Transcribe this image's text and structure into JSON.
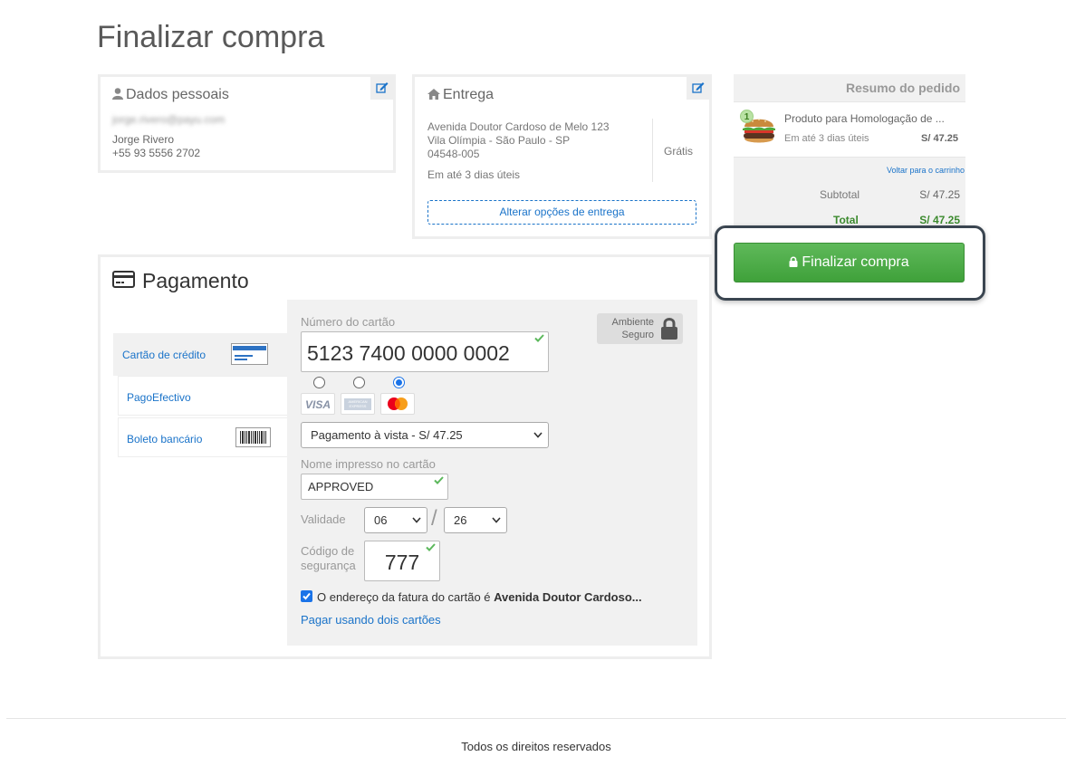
{
  "page": {
    "title": "Finalizar compra"
  },
  "personal": {
    "heading": "Dados pessoais",
    "email": "jorge.rivero@payu.com",
    "name": "Jorge Rivero",
    "phone": "+55 93 5556 2702"
  },
  "shipping": {
    "heading": "Entrega",
    "address_line1": "Avenida Doutor Cardoso de Melo 123",
    "address_line2": "Vila Olímpia - São Paulo - SP",
    "postal_code": "04548-005",
    "eta": "Em até 3 dias úteis",
    "price": "Grátis",
    "change_button": "Alterar opções de entrega"
  },
  "summary": {
    "title": "Resumo do pedido",
    "item": {
      "quantity": "1",
      "name": "Produto para Homologação de ...",
      "eta": "Em até 3 dias úteis",
      "price": "S/ 47.25"
    },
    "back_to_cart": "Voltar para o carrinho",
    "subtotal_label": "Subtotal",
    "subtotal_value": "S/ 47.25",
    "total_label": "Total",
    "total_value": "S/ 47.25"
  },
  "finalize_button": "Finalizar compra",
  "payment": {
    "heading": "Pagamento",
    "tabs": [
      {
        "label": "Cartão de crédito"
      },
      {
        "label": "PagoEfectivo"
      },
      {
        "label": "Boleto bancário"
      }
    ],
    "secure_label_1": "Ambiente",
    "secure_label_2": "Seguro",
    "card_number_label": "Número do cartão",
    "card_number": "5123 7400 0000 0002",
    "brands": [
      "VISA",
      "AMERICAN EXPRESS",
      "Mastercard"
    ],
    "selected_brand": "Mastercard",
    "installments": "Pagamento à vista - S/ 47.25",
    "name_label": "Nome impresso no cartão",
    "name_value": "APPROVED",
    "validity_label": "Validade",
    "month": "06",
    "year": "26",
    "slash": "/",
    "cvv_label_1": "Código de",
    "cvv_label_2": "segurança",
    "cvv": "777",
    "billing_prefix": "O endereço da fatura do cartão é ",
    "billing_address": "Avenida Doutor Cardoso...",
    "two_cards_link": "Pagar usando dois cartões"
  },
  "footer": {
    "text": "Todos os direitos reservados"
  },
  "colors": {
    "link": "#1a73c9",
    "primary_button": "#4cae48",
    "total": "#3c8a2e"
  }
}
